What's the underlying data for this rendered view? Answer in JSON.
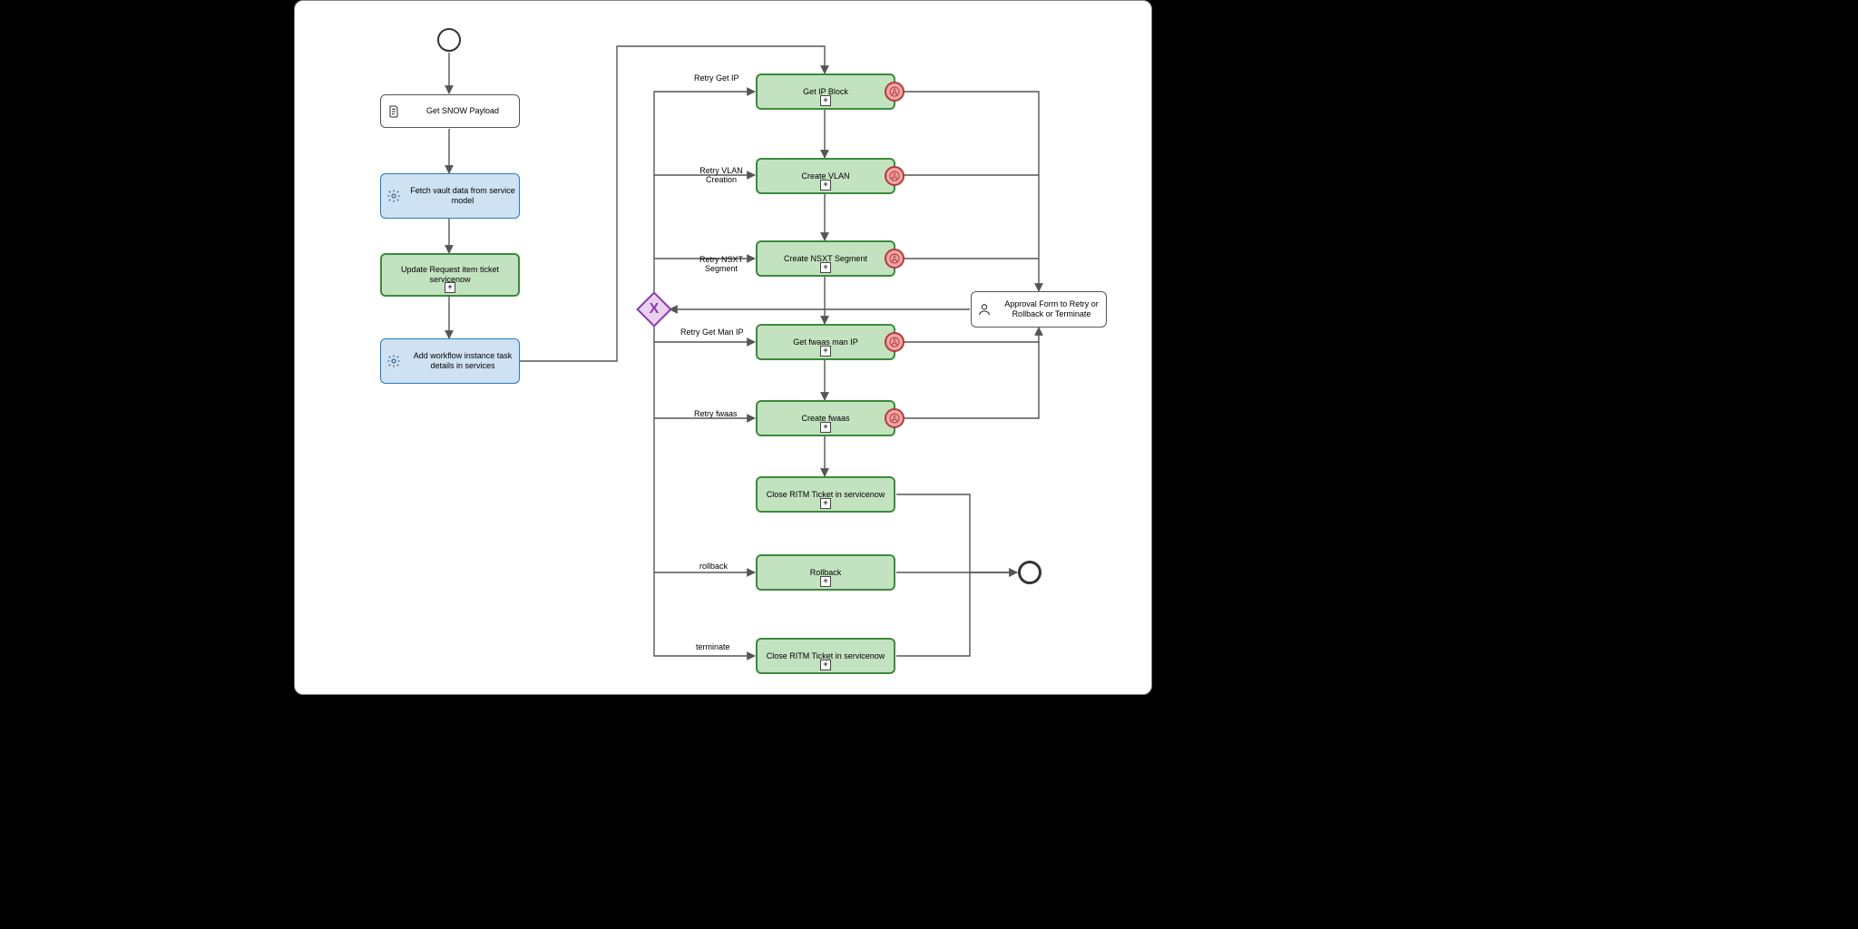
{
  "nodes": {
    "getSnow": {
      "label": "Get SNOW Payload"
    },
    "fetchVault": {
      "label": "Fetch vault data from service model"
    },
    "updateReq": {
      "label": "Update Request item ticket servicenow"
    },
    "addWf": {
      "label": "Add workflow instance task details in services"
    },
    "getIP": {
      "label": "Get IP Block"
    },
    "createVlan": {
      "label": "Create VLAN"
    },
    "createNsxt": {
      "label": "Create NSXT Segment"
    },
    "getFwaasIP": {
      "label": "Get fwaas man IP"
    },
    "createFwaas": {
      "label": "Create fwaas"
    },
    "closeRitm1": {
      "label": "Close RITM Ticket in servicenow"
    },
    "rollback": {
      "label": "Rollback"
    },
    "closeRitm2": {
      "label": "Close RITM Ticket in servicenow"
    },
    "approval": {
      "label": "Approval Form to Retry or Rollback or Terminate"
    }
  },
  "edgeLabels": {
    "retryGetIP": "Retry Get IP",
    "retryVlan": "Retry VLAN Creation",
    "retryNsxt": "Retry NSXT Segment",
    "retryGetManIP": "Retry Get Man IP",
    "retryFwaas": "Retry fwaas",
    "rollback": "rollback",
    "terminate": "terminate"
  }
}
